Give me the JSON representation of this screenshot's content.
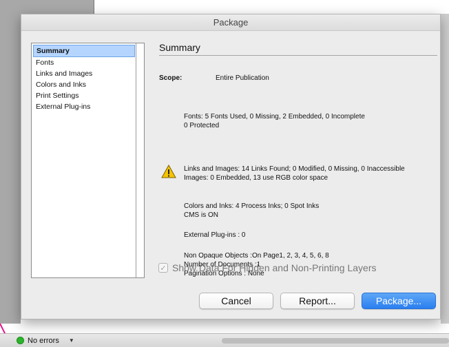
{
  "dialog": {
    "title": "Package"
  },
  "sidebar": {
    "items": [
      {
        "label": "Summary",
        "selected": true
      },
      {
        "label": "Fonts",
        "selected": false
      },
      {
        "label": "Links and Images",
        "selected": false
      },
      {
        "label": "Colors and Inks",
        "selected": false
      },
      {
        "label": "Print Settings",
        "selected": false
      },
      {
        "label": "External Plug-ins",
        "selected": false
      }
    ]
  },
  "summary": {
    "title": "Summary",
    "scope_label": "Scope:",
    "scope_value": "Entire Publication",
    "fonts_line1": "Fonts: 5 Fonts Used, 0 Missing, 2 Embedded, 0 Incomplete",
    "fonts_line2": "0 Protected",
    "links_line1": "Links and Images: 14 Links Found; 0 Modified, 0 Missing, 0 Inaccessible",
    "links_line2": "Images: 0 Embedded, 13 use RGB color space",
    "colors_line1": "Colors and Inks: 4 Process Inks; 0 Spot Inks",
    "colors_line2": "CMS is ON",
    "plugins_line": "External Plug-ins : 0",
    "nonopaque_line": "Non Opaque Objects :On Page1, 2, 3, 4, 5, 6, 8",
    "documents_line": "Number of Documents :1",
    "pagination_line": "Pagination Options : None"
  },
  "options": {
    "show_hidden_label": "Show Data For Hidden and Non-Printing Layers",
    "show_hidden_checked": true
  },
  "buttons": {
    "cancel": "Cancel",
    "report": "Report...",
    "package": "Package..."
  },
  "status_bar": {
    "text": "No errors",
    "status_color": "#2bb52b"
  },
  "colors": {
    "accent": "#2a7ff0",
    "selection": "#b5d5ff",
    "warning": "#f5c400"
  },
  "icons": {
    "warning": "warning-triangle-icon",
    "checkbox": "checkmark-icon",
    "status": "status-dot-icon",
    "dropdown": "chevron-down-icon"
  }
}
